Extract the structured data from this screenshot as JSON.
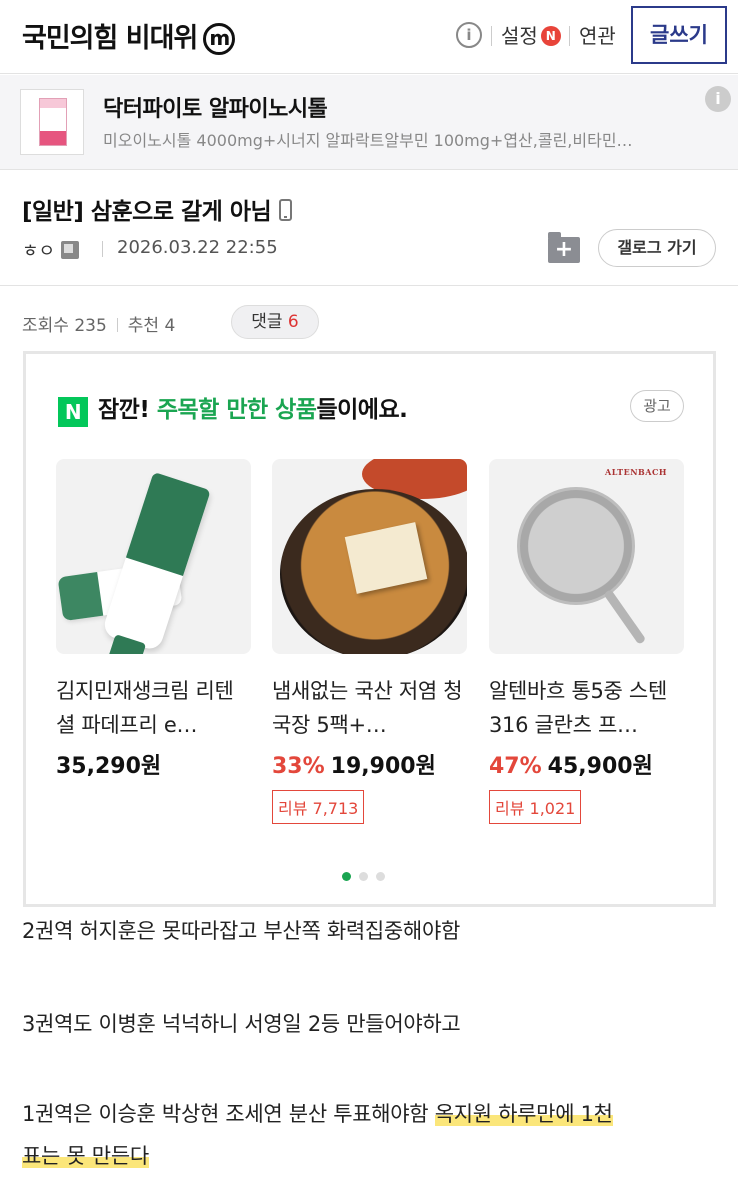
{
  "header": {
    "gallery_title": "국민의힘 비대위",
    "m_badge": "m",
    "info": "i",
    "settings": "설정",
    "settings_badge": "N",
    "related": "연관",
    "write": "글쓰기"
  },
  "ad_banner": {
    "title": "닥터파이토 알파이노시톨",
    "desc": "미오이노시톨 4000mg+시너지 알파락트알부민 100mg+엽산,콜린,비타민…",
    "info": "i"
  },
  "post": {
    "title": "[일반] 삼훈으로 갈게 아님",
    "author": "ㅎㅇ",
    "date": "2026.03.22 22:55",
    "gallery_go": "갤로그 가기",
    "views_label": "조회수 235",
    "recommend_label": "추천 4",
    "reply_label": "댓글",
    "reply_count": "6"
  },
  "reco": {
    "logo": "N",
    "head_prefix": "잠깐! ",
    "head_green": "주목할 만한 상품",
    "head_suffix": "들이에요.",
    "ad_tag": "광고",
    "products": [
      {
        "name": "김지민재생크림 리텐셜 파데프리 e…",
        "discount": "",
        "price": "35,290원",
        "review": ""
      },
      {
        "name": "냄새없는 국산 저염 청국장 5팩+…",
        "discount": "33%",
        "price": "19,900원",
        "review": "리뷰 7,713"
      },
      {
        "name": "알텐바흐 통5중 스텐316 글란츠 프…",
        "discount": "47%",
        "price": "45,900원",
        "review": "리뷰 1,021"
      }
    ],
    "pan_brand": "ALTENBACH"
  },
  "body": {
    "p1": "2권역 허지훈은 못따라잡고 부산쪽 화력집중해야함",
    "p2": "3권역도 이병훈 넉넉하니 서영일 2등 만들어야하고",
    "p3_plain": "1권역은 이승훈 박상현 조세연 분산 투표해야함 ",
    "p3_hl": "옥지원 하루만에 1천",
    "p4_hl": "표는 못 만든다"
  }
}
